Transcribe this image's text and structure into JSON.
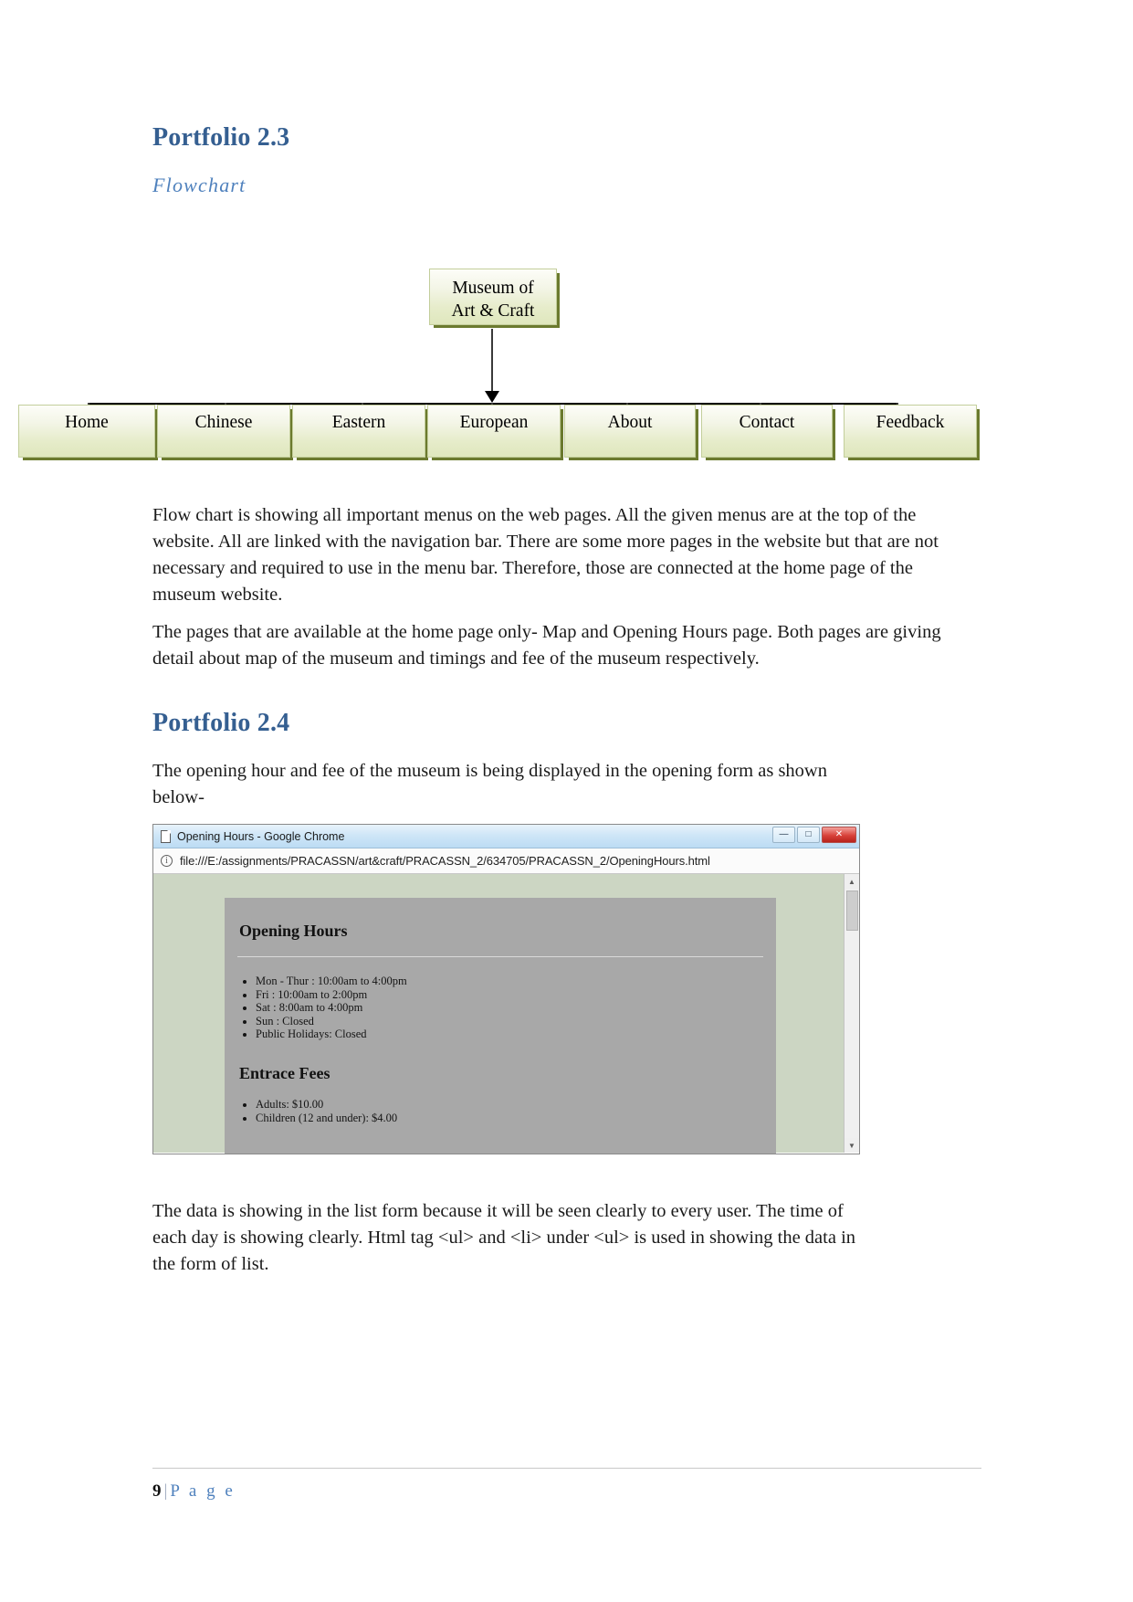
{
  "document": {
    "page_number": "9",
    "footer_separator": "|",
    "footer_label": "P a g e"
  },
  "sections": [
    {
      "heading": "Portfolio 2.3",
      "subheading": "Flowchart"
    },
    {
      "heading": "Portfolio 2.4"
    }
  ],
  "flowchart": {
    "root": {
      "line1": "Museum of",
      "line2": "Art & Craft"
    },
    "menu_nodes": [
      {
        "label": "Home"
      },
      {
        "label": "Chinese"
      },
      {
        "label": "Eastern"
      },
      {
        "label": "European"
      },
      {
        "label": "About"
      },
      {
        "label": "Contact"
      },
      {
        "label": "Feedback"
      }
    ],
    "node_fill_top": "#fdfdf8",
    "node_fill_bottom": "#dfe7bd",
    "node_border": "#c3ce9b",
    "node_shadow": "#6b7a2e",
    "connector_color": "#000000"
  },
  "paragraphs": {
    "p1": "Flow chart is showing all important menus on the web pages. All the given menus are at the top of the website. All are linked with the navigation bar. There are some more pages in the website but that are not necessary and required to use in the menu bar. Therefore, those are connected at the home page of the museum website.",
    "p2": "The pages that are available at the home page only- Map and Opening Hours page. Both pages are giving detail about map of the museum and timings and fee of the museum respectively.",
    "p3": "The opening hour and fee of the museum is being displayed in the opening form as shown below-",
    "p4": "The data is showing in the list form because it will be seen clearly to every user. The time of each day is showing clearly. Html tag <ul> and <li> under <ul> is used in showing the data in the form of list."
  },
  "screenshot": {
    "window_title": "Opening Hours - Google Chrome",
    "url": "file:///E:/assignments/PRACASSN/art&craft/PRACASSN_2/634705/PRACASSN_2/OpeningHours.html",
    "window_controls": {
      "minimize": "—",
      "maximize": "□",
      "close": "✕"
    },
    "scrollbar": {
      "up_arrow": "▲",
      "down_arrow": "▼"
    },
    "page_background": "#ccd6c3",
    "panel_background": "#a8a8a8",
    "content": {
      "heading_1": "Opening Hours",
      "hours": [
        "Mon - Thur : 10:00am to 4:00pm",
        "Fri : 10:00am to 2:00pm",
        "Sat : 8:00am to 4:00pm",
        "Sun : Closed",
        "Public Holidays: Closed"
      ],
      "heading_2": "Entrace Fees",
      "fees": [
        "Adults: $10.00",
        "Children (12 and under): $4.00"
      ]
    }
  }
}
